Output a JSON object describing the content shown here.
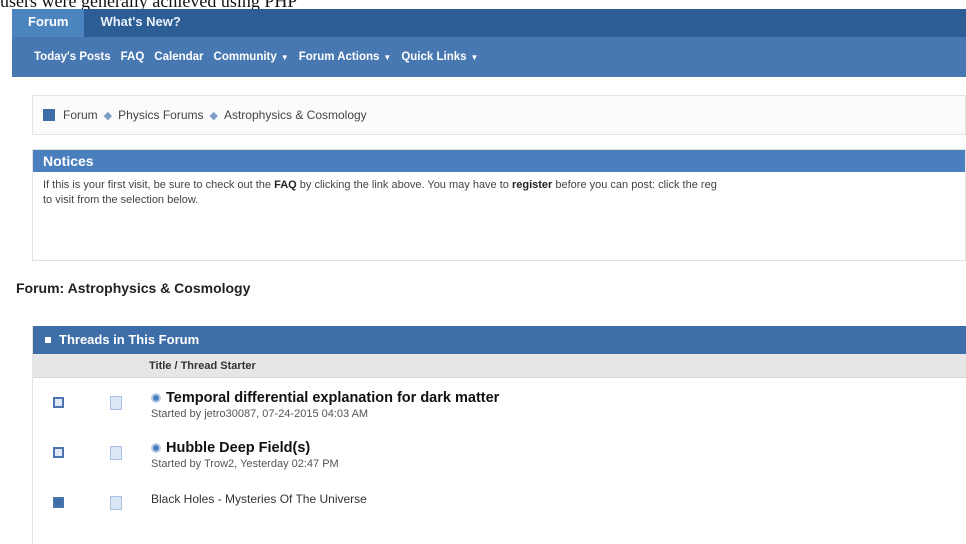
{
  "caption": "users were generally achieved using PHP",
  "nav": {
    "tabs": [
      {
        "label": "Forum"
      },
      {
        "label": "What's New?"
      }
    ],
    "subnav": [
      {
        "label": "Today's Posts"
      },
      {
        "label": "FAQ"
      },
      {
        "label": "Calendar"
      },
      {
        "label": "Community"
      },
      {
        "label": "Forum Actions"
      },
      {
        "label": "Quick Links"
      }
    ],
    "dropdown_caret": "▼"
  },
  "breadcrumb": {
    "items": [
      "Forum",
      "Physics Forums",
      "Astrophysics & Cosmology"
    ],
    "separator": "◆"
  },
  "notices": {
    "title": "Notices",
    "text_before_faq": "If this is your first visit, be sure to check out the ",
    "faq": "FAQ",
    "text_mid": " by clicking the link above. You may have to ",
    "register": "register",
    "text_after": " before you can post: click the reg",
    "line2": "to visit from the selection below."
  },
  "forum_title": "Forum: Astrophysics & Cosmology",
  "threads": {
    "title": "Threads in This Forum",
    "column_title": "Title / Thread Starter",
    "rows": [
      {
        "title": "Temporal differential explanation for dark matter",
        "starter": "Started by jetro30087, 07-24-2015 04:03 AM"
      },
      {
        "title": "Hubble Deep Field(s)",
        "starter": "Started by Trow2, Yesterday 02:47 PM"
      },
      {
        "title": "Black Holes - Mysteries Of The Universe"
      }
    ]
  }
}
